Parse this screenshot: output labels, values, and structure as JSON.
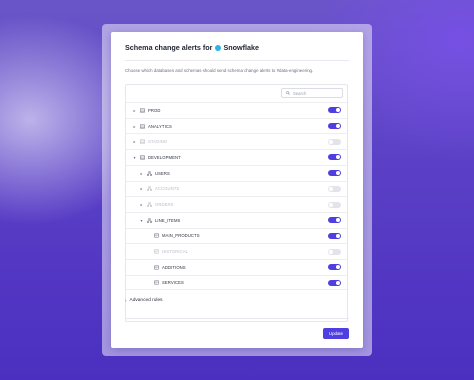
{
  "dialog": {
    "title_prefix": "Schema change alerts for",
    "title_app": "Snowflake",
    "description": "Choose which databases and schemas should send schema change alerts to #data-engineering.",
    "search_placeholder": "Search"
  },
  "tree": {
    "rows": [
      {
        "label": "PROD",
        "level": 0,
        "expanded": false,
        "kind": "database",
        "enabled": true
      },
      {
        "label": "ANALYTICS",
        "level": 0,
        "expanded": false,
        "kind": "database",
        "enabled": true
      },
      {
        "label": "STAGING",
        "level": 0,
        "expanded": false,
        "kind": "database",
        "enabled": false
      },
      {
        "label": "DEVELOPMENT",
        "level": 0,
        "expanded": true,
        "kind": "database",
        "enabled": true
      },
      {
        "label": "USERS",
        "level": 1,
        "expanded": false,
        "kind": "schema",
        "enabled": true
      },
      {
        "label": "ACCOUNTS",
        "level": 1,
        "expanded": false,
        "kind": "schema",
        "enabled": false
      },
      {
        "label": "ORDERS",
        "level": 1,
        "expanded": false,
        "kind": "schema",
        "enabled": false
      },
      {
        "label": "LINE_ITEMS",
        "level": 1,
        "expanded": true,
        "kind": "schema",
        "enabled": true
      },
      {
        "label": "MAIN_PRODUCTS",
        "level": 2,
        "expanded": false,
        "kind": "table",
        "enabled": true
      },
      {
        "label": "HISTORICAL",
        "level": 2,
        "expanded": false,
        "kind": "table",
        "enabled": false
      },
      {
        "label": "ADDITIONS",
        "level": 2,
        "expanded": false,
        "kind": "table",
        "enabled": true
      },
      {
        "label": "SERVICES",
        "level": 2,
        "expanded": false,
        "kind": "table",
        "enabled": true
      }
    ]
  },
  "advanced": {
    "label": "Advanced rules"
  },
  "footer": {
    "update_label": "Update"
  },
  "colors": {
    "accent": "#4f3fe0",
    "snowflake": "#29b5e8"
  }
}
